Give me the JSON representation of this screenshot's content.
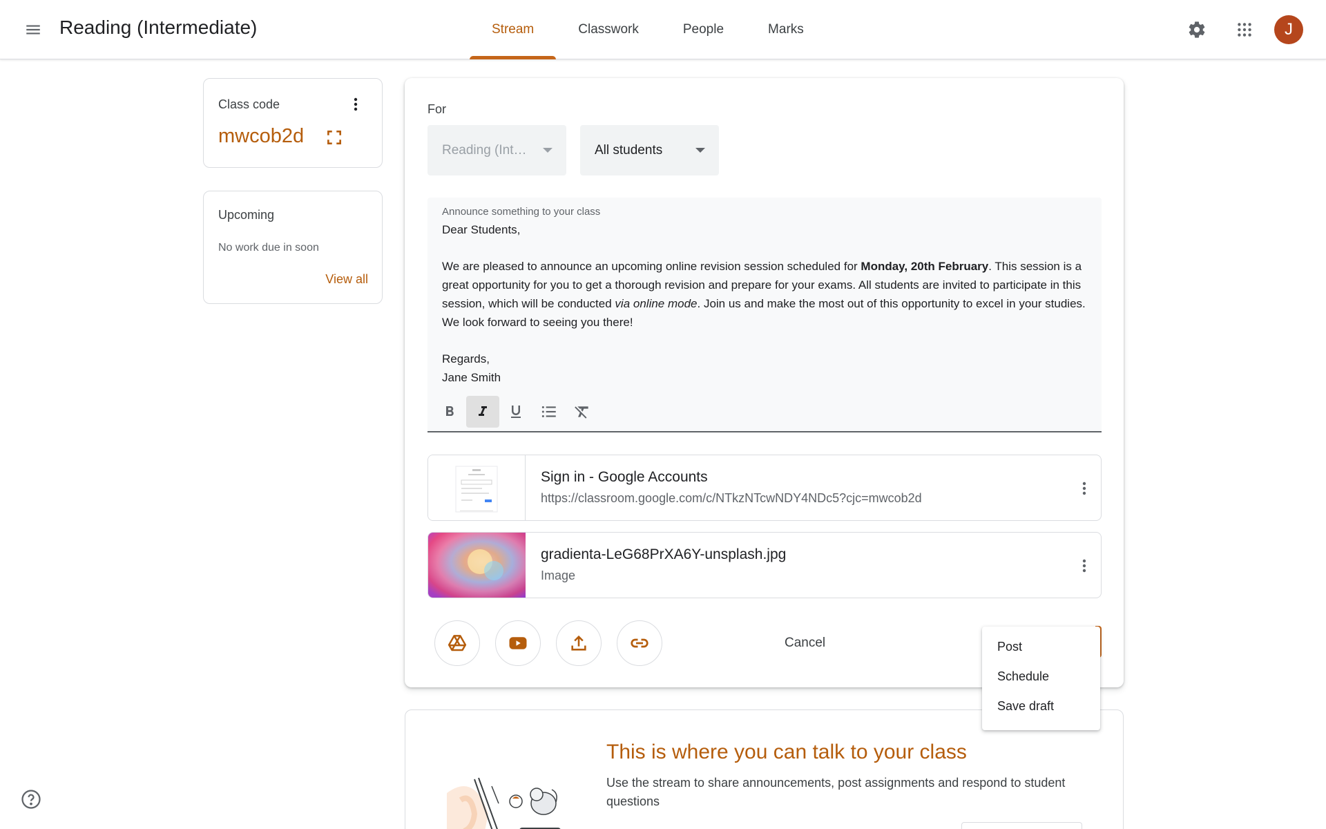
{
  "header": {
    "menu_icon": "hamburger-menu-icon",
    "title": "Reading (Intermediate)",
    "tabs": [
      {
        "label": "Stream",
        "active": true
      },
      {
        "label": "Classwork",
        "active": false
      },
      {
        "label": "People",
        "active": false
      },
      {
        "label": "Marks",
        "active": false
      }
    ],
    "settings_icon": "gear-icon",
    "apps_icon": "grid-apps-icon",
    "avatar_initial": "J",
    "avatar_color": "#b5461c"
  },
  "class_code": {
    "label": "Class code",
    "value": "mwcob2d"
  },
  "upcoming": {
    "title": "Upcoming",
    "text": "No work due in soon",
    "link": "View all"
  },
  "compose": {
    "for_label": "For",
    "class_select": "Reading (Int…",
    "students_select": "All students",
    "placeholder": "Announce something to your class",
    "body": {
      "greeting": "Dear Students,",
      "p1_a": "We are pleased to announce an upcoming online revision session scheduled for ",
      "p1_bold": "Monday, 20th February",
      "p1_b": ". This session is a great opportunity for you to get a thorough revision and prepare for your exams. All students are invited to participate in this session, which will be conducted ",
      "p1_italic": "via online mode",
      "p1_c": ". Join us and make the most out of this opportunity to excel in your studies. We look forward to seeing you there!",
      "closing": "Regards,",
      "signature": "Jane Smith"
    },
    "toolbar": [
      "bold-icon",
      "italic-icon",
      "underline-icon",
      "bulleted-list-icon",
      "clear-formatting-icon"
    ],
    "attachments": [
      {
        "title": "Sign in - Google Accounts",
        "subtitle": "https://classroom.google.com/c/NTkzNTcwNDY4NDc5?cjc=mwcob2d",
        "kind": "link"
      },
      {
        "title": "gradienta-LeG68PrXA6Y-unsplash.jpg",
        "subtitle": "Image",
        "kind": "image"
      }
    ],
    "add_buttons": [
      "google-drive-icon",
      "youtube-icon",
      "upload-icon",
      "link-icon"
    ],
    "cancel_label": "Cancel",
    "post_menu": [
      "Post",
      "Schedule",
      "Save draft"
    ]
  },
  "intro": {
    "title": "This is where you can talk to your class",
    "text": "Use the stream to share announcements, post assignments and respond to student questions"
  },
  "colors": {
    "accent": "#b55d0c",
    "accent_bar": "#c5661a"
  },
  "help_icon": "help-circle-icon"
}
